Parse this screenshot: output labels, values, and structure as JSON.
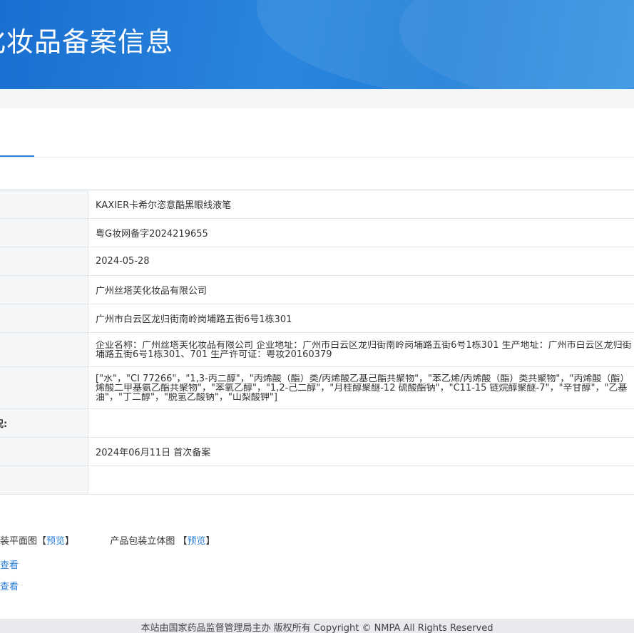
{
  "header": {
    "title": "化妆品备案信息"
  },
  "table": {
    "rows": [
      {
        "label": "",
        "value": "KAXIER卡希尔恣意酷黑眼线液笔"
      },
      {
        "label": "",
        "value": "粤G妆网备字2024219655"
      },
      {
        "label": "",
        "value": "2024-05-28"
      },
      {
        "label": "",
        "value": "广州丝塔芙化妆品有限公司"
      },
      {
        "label": "",
        "value": "广州市白云区龙归街南岭岗埔路五街6号1栋301"
      },
      {
        "label": "",
        "value_lines": [
          "企业名称：广州丝塔芙化妆品有限公司 企业地址：广州市白云区龙归街南岭岗埔路五街6号1栋301 生产地址：广州市白云区龙归街",
          "埔路五街6号1栋301、701 生产许可证：粤妆20160379"
        ]
      },
      {
        "label": "",
        "value_lines": [
          "[\"水\"，\"CI 77266\"，\"1,3-丙二醇\"，\"丙烯酸（酯）类/丙烯酸乙基己酯共聚物\"，\"苯乙烯/丙烯酸（酯）类共聚物\"，\"丙烯酸（酯）",
          "烯酸二甲基氨乙酯共聚物\"，\"苯氧乙醇\"，\"1,2-己二醇\"，\"月桂醇聚醚-12 硫酸酯钠\"，\"C11-15 链烷醇聚醚-7\"，\"辛甘醇\"，\"乙基",
          "油\"，\"丁二醇\"，\"脱氢乙酸钠\"，\"山梨酸钾\"]"
        ]
      },
      {
        "label": "况:",
        "value": ""
      },
      {
        "label": "",
        "value": "2024年06月11日 首次备案"
      },
      {
        "label": "",
        "value": ""
      }
    ]
  },
  "packaging": {
    "flat_label": "装平面图",
    "flat_link": "预览",
    "stereo_label": "产品包装立体图",
    "stereo_link": "预览",
    "links": [
      "查看",
      "查看"
    ]
  },
  "footer": {
    "text": "本站由国家药品监督管理局主办 版权所有 Copyright © NMPA All Rights Reserved"
  }
}
